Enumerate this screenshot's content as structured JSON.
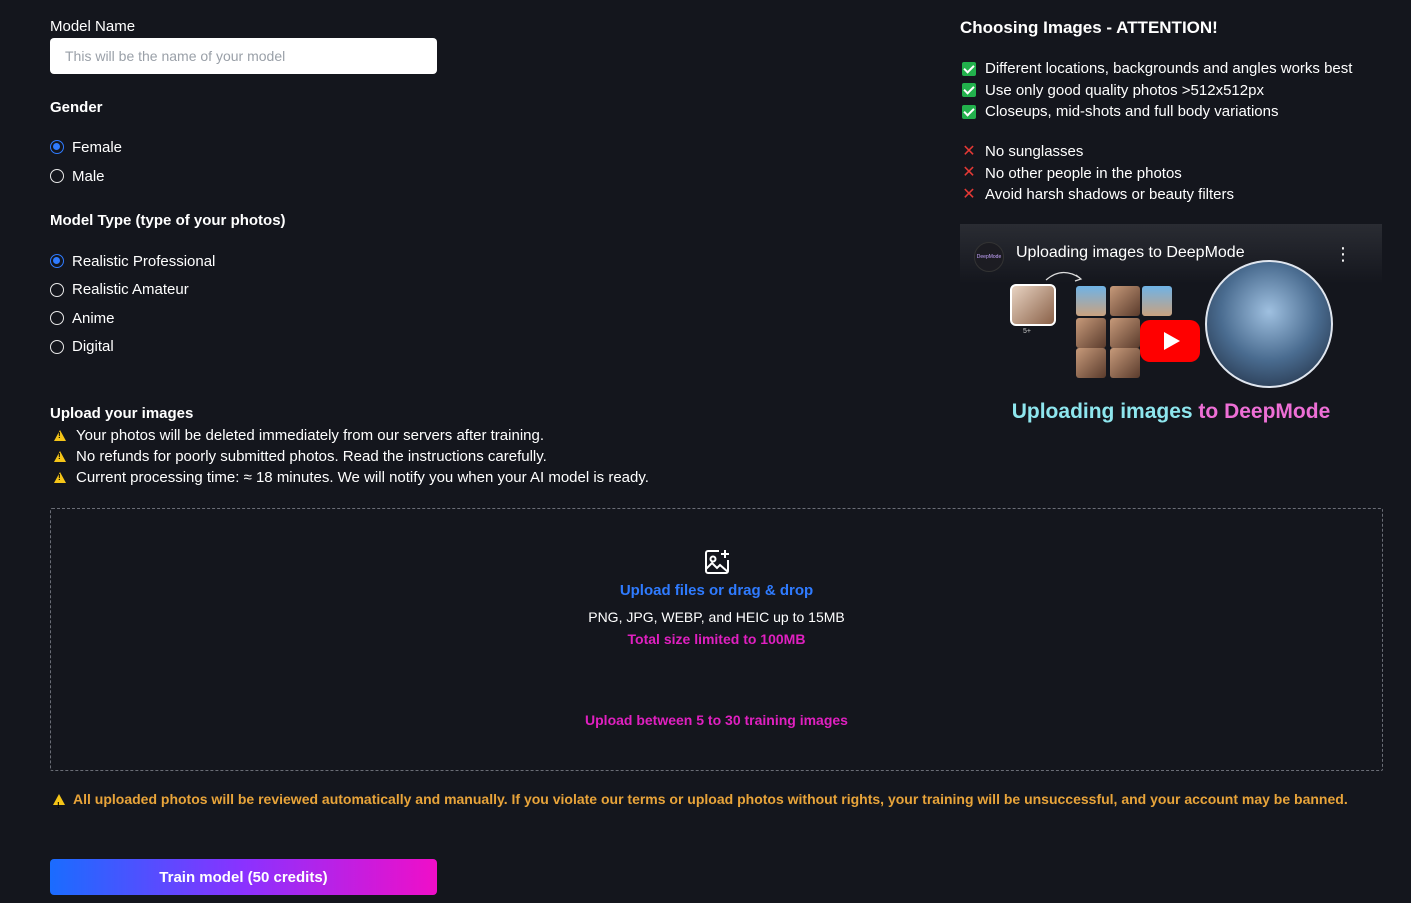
{
  "form": {
    "model_name_label": "Model Name",
    "model_name_placeholder": "This will be the name of your model",
    "model_name_value": "",
    "gender_title": "Gender",
    "gender_options": [
      {
        "label": "Female",
        "selected": true
      },
      {
        "label": "Male",
        "selected": false
      }
    ],
    "model_type_title": "Model Type (type of your photos)",
    "model_type_options": [
      {
        "label": "Realistic Professional",
        "selected": true
      },
      {
        "label": "Realistic Amateur",
        "selected": false
      },
      {
        "label": "Anime",
        "selected": false
      },
      {
        "label": "Digital",
        "selected": false
      }
    ]
  },
  "upload": {
    "title": "Upload your images",
    "warnings": [
      "Your photos will be deleted immediately from our servers after training.",
      "No refunds for poorly submitted photos. Read the instructions carefully.",
      "Current processing time: ≈ 18 minutes. We will notify you when your AI model is ready."
    ],
    "dropzone": {
      "link_text": "Upload files or drag & drop",
      "formats": "PNG, JPG, WEBP, and HEIC up to 15MB",
      "size_limit": "Total size limited to 100MB",
      "count_hint": "Upload between 5 to 30 training images"
    },
    "notice": "All uploaded photos will be reviewed automatically and manually. If you violate our terms or upload photos without rights, your training will be unsuccessful, and your account may be banned.",
    "train_button": "Train model (50 credits)"
  },
  "guide": {
    "title": "Choosing Images - ATTENTION!",
    "dos": [
      "Different locations, backgrounds and angles works best",
      "Use only good quality photos >512x512px",
      "Closeups, mid-shots and full body variations"
    ],
    "donts": [
      "No sunglasses",
      "No other people in the photos",
      "Avoid harsh shadows or beauty filters"
    ],
    "video": {
      "channel_logo_text": "DeepMode",
      "title": "Uploading images to DeepMode",
      "caption_part1": "Uploading images",
      "caption_part2": " to DeepMode",
      "thumb_count_label": "5+"
    }
  },
  "colors": {
    "background": "#14161d",
    "accent_blue": "#2f7bff",
    "accent_pink": "#e020c0",
    "notice_orange": "#e8a43a",
    "check_green": "#22b14c",
    "cross_red": "#e53935"
  }
}
